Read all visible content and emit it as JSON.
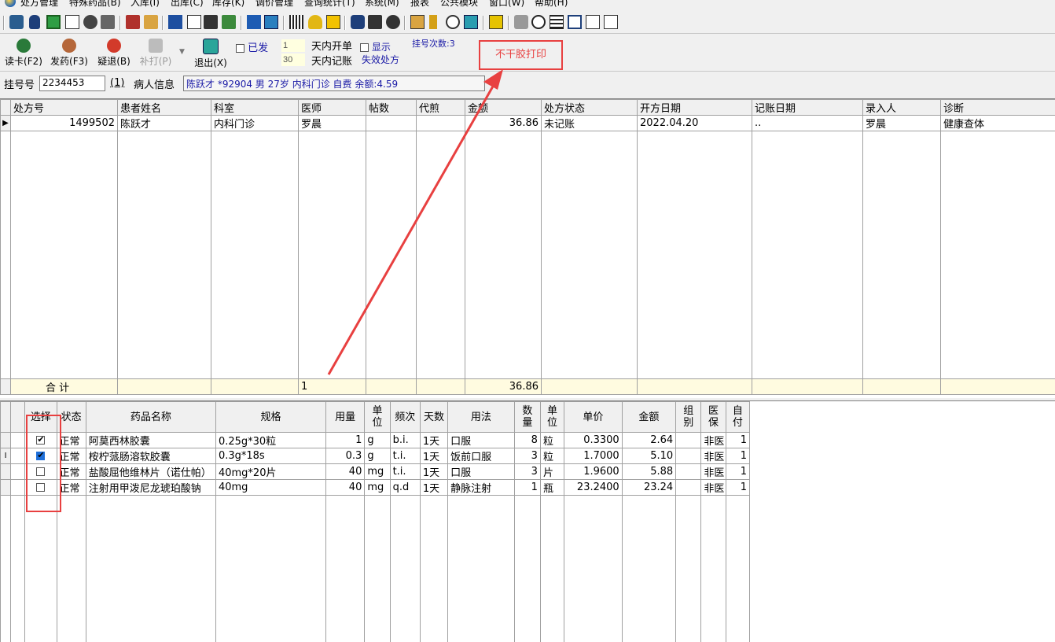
{
  "menu": [
    "处方管理",
    "特殊药品(B)",
    "入库(I)",
    "出库(C)",
    "库存(K)",
    "调价管理",
    "查询统计(T)",
    "系统(M)",
    "报表",
    "公共模块",
    "窗口(W)",
    "帮助(H)"
  ],
  "toolbar_icons": [
    "id-card-icon",
    "bottle-icon",
    "check-box-icon",
    "document-icon",
    "binoculars-icon",
    "cart-icon",
    "book-icon",
    "printer-icon",
    "notes-icon",
    "checkmark-icon",
    "export-icon",
    "refresh-icon",
    "edit-icon",
    "report-icon",
    "grid-icon",
    "bell-icon",
    "calculator-icon",
    "pill-icon",
    "flag-icon",
    "binocular2-icon",
    "folder-icon",
    "thermometer-icon",
    "zoom-icon",
    "close-box-icon",
    "upload-icon",
    "cube-icon",
    "search-icon",
    "list-icon",
    "window-icon",
    "edit2-icon",
    "clipboard-icon"
  ],
  "actions": {
    "read_card": "读卡(F2)",
    "dispense": "发药(F3)",
    "doubtful_return": "疑退(B)",
    "reprint": "补打(P)",
    "exit": "退出(X)",
    "already_sent": "已发",
    "days_open_value": "1",
    "days_open_label": "天内开单",
    "days_charge_value": "30",
    "days_charge_label": "天内记账",
    "show_label": "显示",
    "show_invalid": "失效处方",
    "reg_count": "挂号次数:3"
  },
  "callout_text": "不干胶打印",
  "info": {
    "reg_no_label": "挂号号",
    "reg_no_value": "2234453",
    "count_label": "(1)",
    "patient_label": "病人信息",
    "patient_value": "陈跃才 *92904 男  27岁 内科门诊 自费 余额:4.59"
  },
  "prescriptions": {
    "columns": [
      "处方号",
      "患者姓名",
      "科室",
      "医师",
      "帖数",
      "代煎",
      "金额",
      "处方状态",
      "开方日期",
      "记账日期",
      "录入人",
      "诊断"
    ],
    "rows": [
      {
        "id": "1499502",
        "name": "陈跃才",
        "dept": "内科门诊",
        "doctor": "罗晨",
        "tie": "",
        "daijian": "",
        "amount": "36.86",
        "status": "未记账",
        "open_date": "2022.04.20",
        "charge_date": "..",
        "entry": "罗晨",
        "diagnosis": "健康查体"
      }
    ],
    "summary": {
      "label": "合  计",
      "doctor_count": "1",
      "amount": "36.86"
    }
  },
  "drugs": {
    "columns": [
      "选择",
      "状态",
      "药品名称",
      "规格",
      "用量",
      "单\n位",
      "频次",
      "天数",
      "用法",
      "数\n量",
      "单\n位",
      "单价",
      "金额",
      "组\n别",
      "医\n保",
      "自\n付"
    ],
    "rows": [
      {
        "checked": true,
        "status": "正常",
        "name": "阿莫西林胶囊",
        "spec": "0.25g*30粒",
        "dose": "1",
        "unit": "g",
        "freq": "b.i.",
        "days": "1天",
        "usage": "口服",
        "qty": "8",
        "qunit": "粒",
        "price": "0.3300",
        "amount": "2.64",
        "group": "",
        "insurance": "非医",
        "self": "1"
      },
      {
        "checked": true,
        "status": "正常",
        "name": "桉柠蒎肠溶软胶囊",
        "spec": "0.3g*18s",
        "dose": "0.3",
        "unit": "g",
        "freq": "t.i.",
        "days": "1天",
        "usage": "饭前口服",
        "qty": "3",
        "qunit": "粒",
        "price": "1.7000",
        "amount": "5.10",
        "group": "",
        "insurance": "非医",
        "self": "1"
      },
      {
        "checked": false,
        "status": "正常",
        "name": "盐酸屈他维林片（诺仕帕）",
        "spec": "40mg*20片",
        "dose": "40",
        "unit": "mg",
        "freq": "t.i.",
        "days": "1天",
        "usage": "口服",
        "qty": "3",
        "qunit": "片",
        "price": "1.9600",
        "amount": "5.88",
        "group": "",
        "insurance": "非医",
        "self": "1"
      },
      {
        "checked": false,
        "status": "正常",
        "name": "注射用甲泼尼龙琥珀酸钠",
        "spec": "40mg",
        "dose": "40",
        "unit": "mg",
        "freq": "q.d",
        "days": "1天",
        "usage": "静脉注射",
        "qty": "1",
        "qunit": "瓶",
        "price": "23.2400",
        "amount": "23.24",
        "group": "",
        "insurance": "非医",
        "self": "1"
      }
    ]
  },
  "colors": {
    "accent_red": "#e84040",
    "summary_bg": "#fffbe0",
    "selected_check": "#1e6fd9"
  }
}
